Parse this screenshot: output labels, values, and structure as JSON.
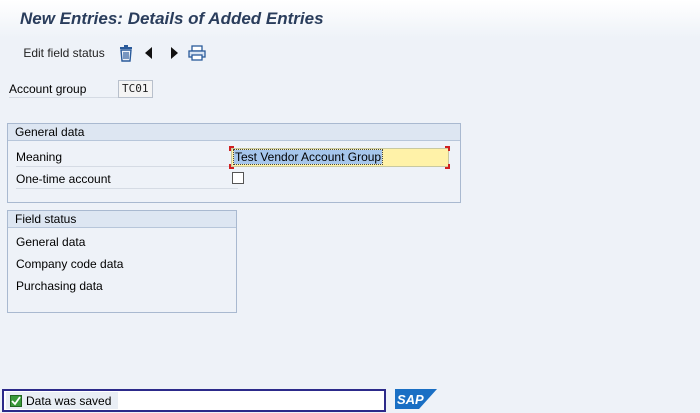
{
  "header": {
    "title": "New Entries: Details of Added Entries"
  },
  "toolbar": {
    "edit_field_status": "Edit field status",
    "icons": [
      "delete-icon",
      "previous-entry-icon",
      "next-entry-icon",
      "print-icon"
    ]
  },
  "account_group": {
    "label": "Account group",
    "value": "TC01"
  },
  "general_data": {
    "heading": "General data",
    "meaning_label": "Meaning",
    "meaning_value": "Test Vendor Account Group",
    "one_time_label": "One-time account",
    "one_time_checked": false
  },
  "field_status": {
    "heading": "Field status",
    "items": [
      "General data",
      "Company code data",
      "Purchasing data"
    ]
  },
  "status": {
    "message": "Data was saved",
    "type": "success"
  },
  "logo": {
    "text": "SAP"
  },
  "colors": {
    "title": "#2a3d5c",
    "background": "#eef2f8",
    "highlight": "#fff2a8",
    "status_border": "#2c2a8a",
    "sap_blue": "#1a6fc4"
  }
}
